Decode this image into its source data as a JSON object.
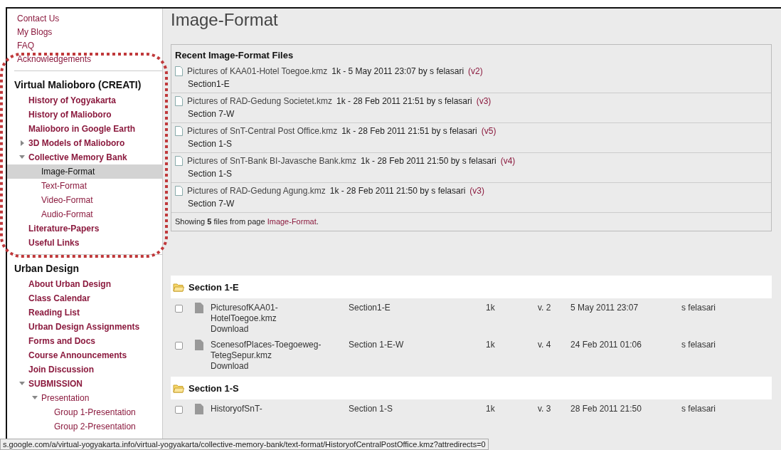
{
  "sidebar": {
    "top_links": [
      "Contact Us",
      "My Blogs",
      "FAQ",
      "Acknowledgements"
    ],
    "sections": [
      {
        "title": "Virtual Malioboro (CREATI)",
        "items": [
          {
            "label": "History of Yogyakarta",
            "selected": false
          },
          {
            "label": "History of Malioboro",
            "selected": false
          },
          {
            "label": "Malioboro in Google Earth",
            "selected": false
          },
          {
            "label": "3D Models of Malioboro",
            "selected": false,
            "expanded": false
          },
          {
            "label": "Collective Memory Bank",
            "selected": false,
            "expanded": true,
            "children": [
              {
                "label": "Image-Format",
                "selected": true
              },
              {
                "label": "Text-Format",
                "selected": false
              },
              {
                "label": "Video-Format",
                "selected": false
              },
              {
                "label": "Audio-Format",
                "selected": false
              }
            ]
          },
          {
            "label": "Literature-Papers",
            "selected": false
          },
          {
            "label": "Useful Links",
            "selected": false
          }
        ]
      },
      {
        "title": "Urban Design",
        "items": [
          {
            "label": "About Urban Design",
            "selected": false
          },
          {
            "label": "Class Calendar",
            "selected": false
          },
          {
            "label": "Reading List",
            "selected": false
          },
          {
            "label": "Urban Design Assignments",
            "selected": false
          },
          {
            "label": "Forms and Docs",
            "selected": false
          },
          {
            "label": "Course Announcements",
            "selected": false
          },
          {
            "label": "Join Discussion",
            "selected": false
          },
          {
            "label": "SUBMISSION",
            "selected": false,
            "expanded": true,
            "children": [
              {
                "label": "Presentation",
                "selected": false,
                "expanded": true,
                "children": [
                  {
                    "label": "Group 1-Presentation",
                    "selected": false
                  },
                  {
                    "label": "Group 2-Presentation",
                    "selected": false
                  }
                ]
              }
            ]
          }
        ]
      }
    ]
  },
  "page_title": "Image-Format",
  "recent": {
    "title": "Recent Image-Format Files",
    "files": [
      {
        "name": "Pictures of KAA01-Hotel Toegoe.kmz",
        "info": "1k - 5 May 2011 23:07 by s felasari",
        "version": "(v2)",
        "section": "Section1-E"
      },
      {
        "name": "Pictures of RAD-Gedung Societet.kmz",
        "info": "1k - 28 Feb 2011 21:51 by s felasari",
        "version": "(v3)",
        "section": "Section 7-W"
      },
      {
        "name": "Pictures of SnT-Central Post Office.kmz",
        "info": "1k - 28 Feb 2011 21:51 by s felasari",
        "version": "(v5)",
        "section": "Section 1-S"
      },
      {
        "name": "Pictures of SnT-Bank BI-Javasche Bank.kmz",
        "info": "1k - 28 Feb 2011 21:50 by s felasari",
        "version": "(v4)",
        "section": "Section 1-S"
      },
      {
        "name": "Pictures of RAD-Gedung Agung.kmz",
        "info": "1k - 28 Feb 2011 21:50 by s felasari",
        "version": "(v3)",
        "section": "Section 7-W"
      }
    ],
    "footer": {
      "prefix": "Showing **5** files from page",
      "link": "Image-Format",
      "suffix": "."
    }
  },
  "file_groups": [
    {
      "title": "Section 1-E",
      "files": [
        {
          "checked": false,
          "name": [
            "PicturesofKAA01-",
            "HotelToegoe.kmz"
          ],
          "download": "Download",
          "section": "Section1-E",
          "size": "1k",
          "version": "v. 2",
          "date": "5 May 2011 23:07",
          "owner": "s felasari"
        },
        {
          "checked": false,
          "name": [
            "ScenesofPlaces-Toegoeweg-",
            "TetegSepur.kmz"
          ],
          "download": "Download",
          "section": "Section 1-E-W",
          "size": "1k",
          "version": "v. 4",
          "date": "24 Feb 2011 01:06",
          "owner": "s felasari"
        }
      ]
    },
    {
      "title": "Section 1-S",
      "files": [
        {
          "checked": false,
          "name": [
            "HistoryofSnT-"
          ],
          "section": "Section 1-S",
          "size": "1k",
          "version": "v. 3",
          "date": "28 Feb 2011 21:50",
          "owner": "s felasari"
        }
      ]
    }
  ],
  "status_bar": "s.google.com/a/virtual-yogyakarta.info/virtual-yogyakarta/collective-memory-bank/text-format/HistoryofCentralPostOffice.kmz?attredirects=0"
}
